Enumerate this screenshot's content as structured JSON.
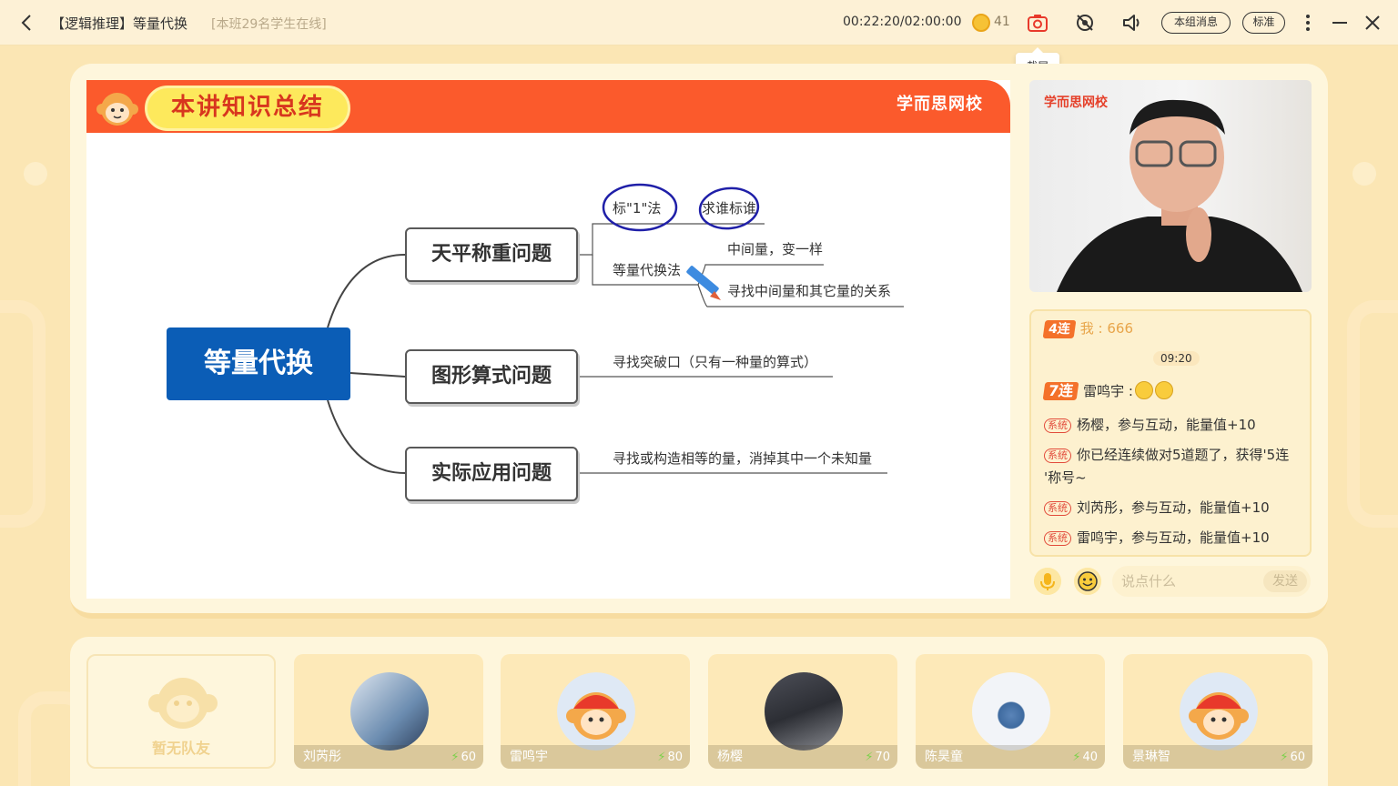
{
  "header": {
    "title": "【逻辑推理】等量代换",
    "online_text": "[本班29名学生在线]",
    "timer": "00:22:20/02:00:00",
    "coins": "41",
    "group_msg_label": "本组消息",
    "standard_label": "标准",
    "screenshot_tooltip": "截屏"
  },
  "slide": {
    "summary_title": "本讲知识总结",
    "brand": "学而思网校",
    "center": "等量代换",
    "nodes": [
      "天平称重问题",
      "图形算式问题",
      "实际应用问题"
    ],
    "branch1": {
      "top_left": "标\"1\"法",
      "top_right": "求谁标谁",
      "method": "等量代换法",
      "sub1": "中间量，变一样",
      "sub2": "寻找中间量和其它量的关系"
    },
    "branch2": "寻找突破口（只有一种量的算式）",
    "branch3": "寻找或构造相等的量，消掉其中一个未知量"
  },
  "video": {
    "brand": "学而思网校"
  },
  "chat": {
    "messages": [
      {
        "badge": "4连",
        "user": "我",
        "text": "666"
      },
      {
        "time": "09:20"
      },
      {
        "badge": "7连",
        "user": "雷鸣宇"
      },
      {
        "sys": "系统",
        "text": "杨樱，参与互动，能量值+10"
      },
      {
        "sys": "系统",
        "text": "你已经连续做对5道题了，获得'5连",
        "text2": "'称号~"
      },
      {
        "sys": "系统",
        "text": "刘芮彤，参与互动，能量值+10"
      },
      {
        "sys": "系统",
        "text": "雷鸣宇，参与互动，能量值+10"
      }
    ],
    "input_placeholder": "说点什么",
    "send_label": "发送"
  },
  "team": {
    "no_teammate": "暂无队友",
    "members": [
      {
        "name": "刘芮彤",
        "score": "60"
      },
      {
        "name": "雷鸣宇",
        "score": "80"
      },
      {
        "name": "杨樱",
        "score": "70"
      },
      {
        "name": "陈昊童",
        "score": "40"
      },
      {
        "name": "景琳智",
        "score": "60"
      }
    ]
  },
  "colors": {
    "accent": "#fb5a2c",
    "center_node": "#0b5db6",
    "background": "#fbe6b4"
  }
}
